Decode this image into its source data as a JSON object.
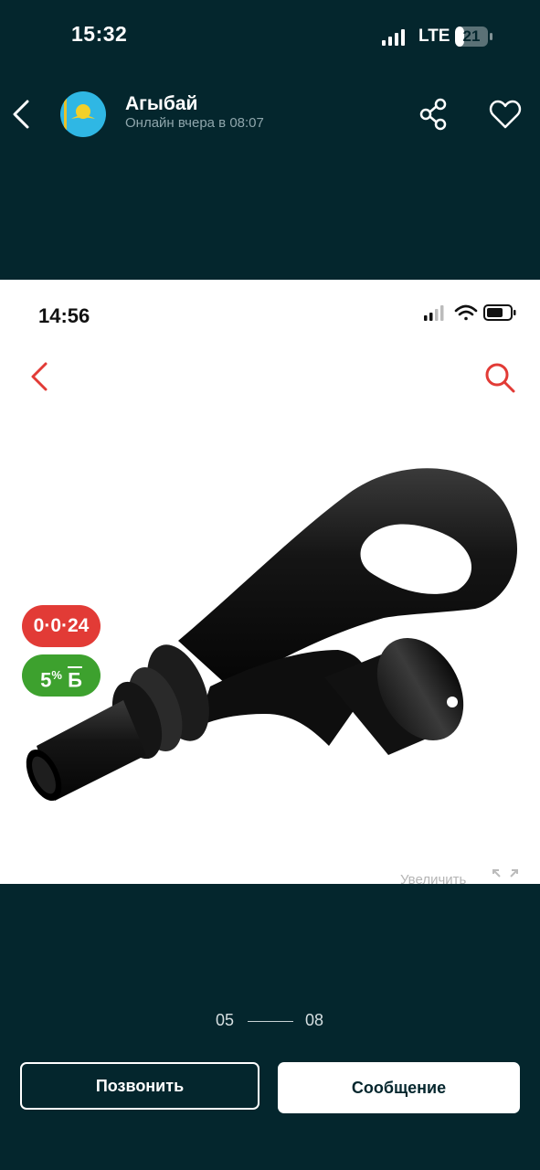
{
  "status_bar": {
    "time": "15:32",
    "network": "LTE",
    "battery": "21"
  },
  "header": {
    "seller_name": "Агыбай",
    "seller_status": "Онлайн вчера в 08:07",
    "icons": [
      "back-arrow-icon",
      "kazakhstan-flag-avatar",
      "share-icon",
      "heart-icon"
    ]
  },
  "inner_screenshot": {
    "time": "14:56",
    "icons": [
      "back-arrow-icon",
      "search-icon",
      "signal-icon",
      "wifi-icon",
      "battery-icon"
    ],
    "badge_installment": "0·0·24",
    "badge_bonus_value": "5",
    "badge_bonus_unit": "%",
    "badge_bonus_letter": "Б",
    "zoom_label": "Увеличить",
    "accent_color": "#e23b36",
    "bonus_color": "#3da12e"
  },
  "pager": {
    "current": "05",
    "total": "08"
  },
  "actions": {
    "call_label": "Позвонить",
    "message_label": "Сообщение"
  },
  "colors": {
    "background": "#04262d"
  }
}
